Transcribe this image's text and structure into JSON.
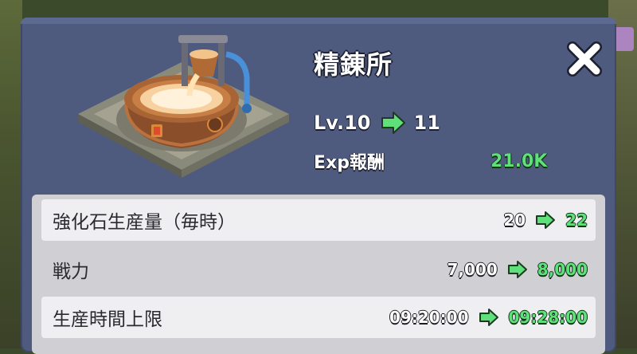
{
  "colors": {
    "panel": "#4f5b7e",
    "row_light": "#efeff1",
    "row_dark": "#cfcfd4",
    "upgrade_green": "#5fe07a"
  },
  "building": {
    "name": "精錬所",
    "image": "refinery-cauldron"
  },
  "level": {
    "current": "Lv.10",
    "next": "11"
  },
  "exp": {
    "label": "Exp報酬",
    "value": "21.0K"
  },
  "stats": [
    {
      "label": "強化石生産量（毎時）",
      "current": "20",
      "next": "22"
    },
    {
      "label": "戦力",
      "current": "7,000",
      "next": "8,000"
    },
    {
      "label": "生産時間上限",
      "current": "09:20:00",
      "next": "09:28:00"
    }
  ],
  "icons": {
    "close": "close-icon",
    "arrow": "green-arrow-icon"
  }
}
